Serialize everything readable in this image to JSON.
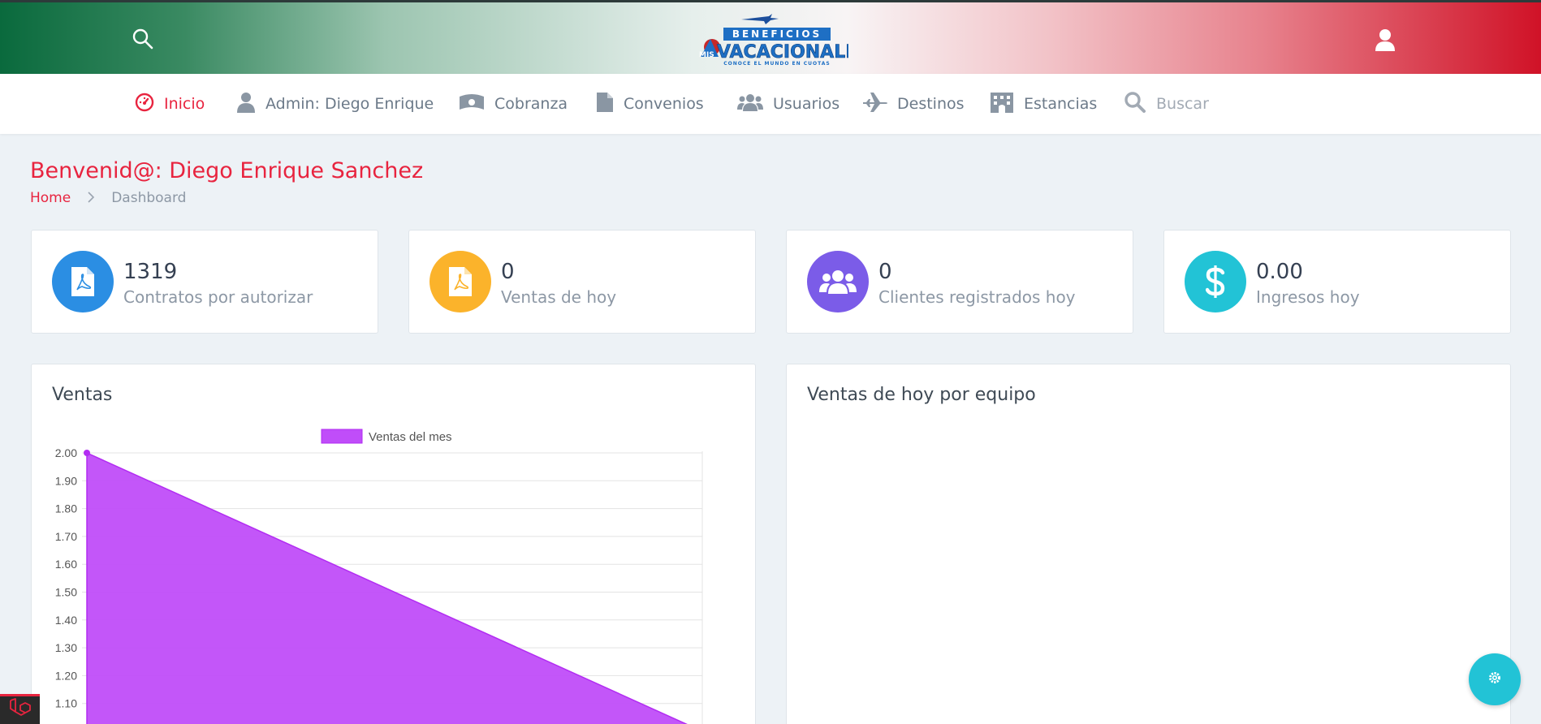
{
  "header": {
    "logo": {
      "line1": "BENEFICIOS",
      "line2_small": "MIS",
      "line2": "VACACIONALES",
      "tagline": "CONOCE EL MUNDO EN CUOTAS"
    },
    "search_icon": "search-icon",
    "user_icon": "user-icon"
  },
  "nav": {
    "items": [
      {
        "label": "Inicio",
        "icon": "dashboard-icon",
        "active": true
      },
      {
        "label": "Admin: Diego Enrique",
        "icon": "user-icon"
      },
      {
        "label": "Cobranza",
        "icon": "money-icon"
      },
      {
        "label": "Convenios",
        "icon": "file-icon"
      },
      {
        "label": "Usuarios",
        "icon": "users-icon"
      },
      {
        "label": "Destinos",
        "icon": "plane-icon"
      },
      {
        "label": "Estancias",
        "icon": "building-icon"
      },
      {
        "label": "Buscar",
        "icon": "search-icon"
      }
    ]
  },
  "page": {
    "title": "Benvenid@: Diego Enrique Sanchez",
    "breadcrumb": {
      "home": "Home",
      "current": "Dashboard"
    }
  },
  "stats": [
    {
      "value": "1319",
      "label": "Contratos por autorizar",
      "color": "#2b8ee3",
      "icon": "pdf-file-icon"
    },
    {
      "value": "0",
      "label": "Ventas de hoy",
      "color": "#fbb32b",
      "icon": "pdf-file-icon"
    },
    {
      "value": "0",
      "label": "Clientes registrados hoy",
      "color": "#7b5ce8",
      "icon": "users-icon"
    },
    {
      "value": "0.00",
      "label": "Ingresos hoy",
      "color": "#22c3d6",
      "icon": "dollar-icon"
    }
  ],
  "panels": {
    "ventas_title": "Ventas",
    "equipo_title": "Ventas de hoy por equipo"
  },
  "chart_data": {
    "type": "area",
    "title": "Ventas",
    "series": [
      {
        "name": "Ventas del mes",
        "color": "#c04df9",
        "x": [
          0,
          1
        ],
        "values": [
          2.0,
          1.0
        ]
      }
    ],
    "yticks": [
      "2.00",
      "1.90",
      "1.80",
      "1.70",
      "1.60",
      "1.50",
      "1.40",
      "1.30",
      "1.20",
      "1.10"
    ],
    "ylim": [
      1.0,
      2.0
    ],
    "grid": true,
    "legend": "top"
  },
  "fab": {
    "icon": "gear-icon"
  },
  "corner": {
    "icon": "laravel-icon"
  }
}
